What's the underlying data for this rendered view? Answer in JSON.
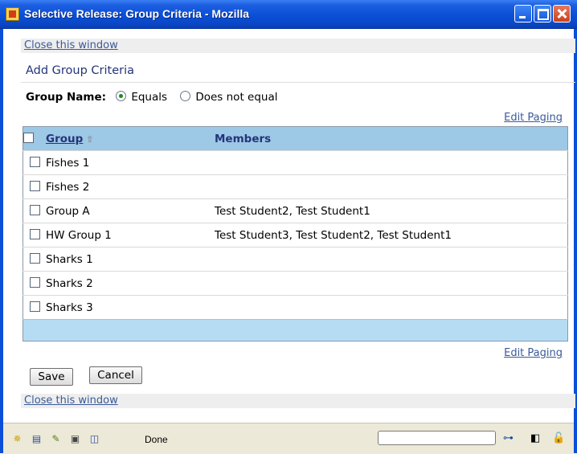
{
  "window": {
    "title": "Selective Release: Group Criteria - Mozilla"
  },
  "links": {
    "close_top": "Close this window",
    "close_bottom": "Close this window",
    "edit_paging_top": "Edit Paging",
    "edit_paging_bottom": "Edit Paging"
  },
  "section": {
    "title": "Add Group Criteria"
  },
  "criteria": {
    "label": "Group Name:",
    "options": [
      "Equals",
      "Does not equal"
    ],
    "selected": "Equals"
  },
  "table": {
    "headers": {
      "group": "Group",
      "members": "Members"
    },
    "rows": [
      {
        "group": "Fishes 1",
        "members": ""
      },
      {
        "group": "Fishes 2",
        "members": ""
      },
      {
        "group": "Group A",
        "members": "Test Student2, Test Student1"
      },
      {
        "group": "HW Group 1",
        "members": "Test Student3, Test Student2, Test Student1"
      },
      {
        "group": "Sharks 1",
        "members": ""
      },
      {
        "group": "Sharks 2",
        "members": ""
      },
      {
        "group": "Sharks 3",
        "members": ""
      }
    ]
  },
  "buttons": {
    "save": "Save",
    "cancel": "Cancel"
  },
  "status": {
    "text": "Done"
  },
  "colors": {
    "titlebar": "#0b4fd8",
    "header_row": "#9dc8e6",
    "footer_row": "#b6dcf4",
    "link": "#3a5a99",
    "heading": "#24347a"
  }
}
